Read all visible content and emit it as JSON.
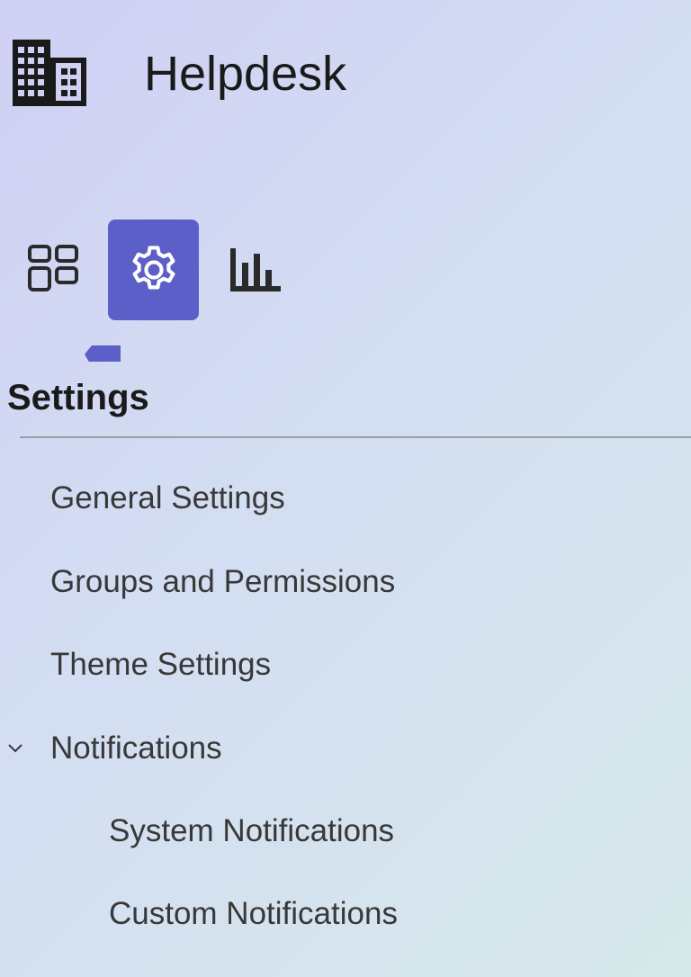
{
  "app": {
    "title": "Helpdesk",
    "icon": "building-icon"
  },
  "icon_tabs": [
    {
      "icon": "apps-grid-icon",
      "active": false
    },
    {
      "icon": "gear-icon",
      "active": true
    },
    {
      "icon": "bar-chart-icon",
      "active": false
    }
  ],
  "accent_color": "#5b5fc7",
  "section": {
    "title": "Settings"
  },
  "nav": {
    "general": "General Settings",
    "groups": "Groups and Permissions",
    "theme": "Theme Settings",
    "notifications": {
      "label": "Notifications",
      "expanded": true,
      "chevron_icon": "chevron-down-icon",
      "children": {
        "system": "System Notifications",
        "custom": "Custom Notifications"
      }
    }
  }
}
